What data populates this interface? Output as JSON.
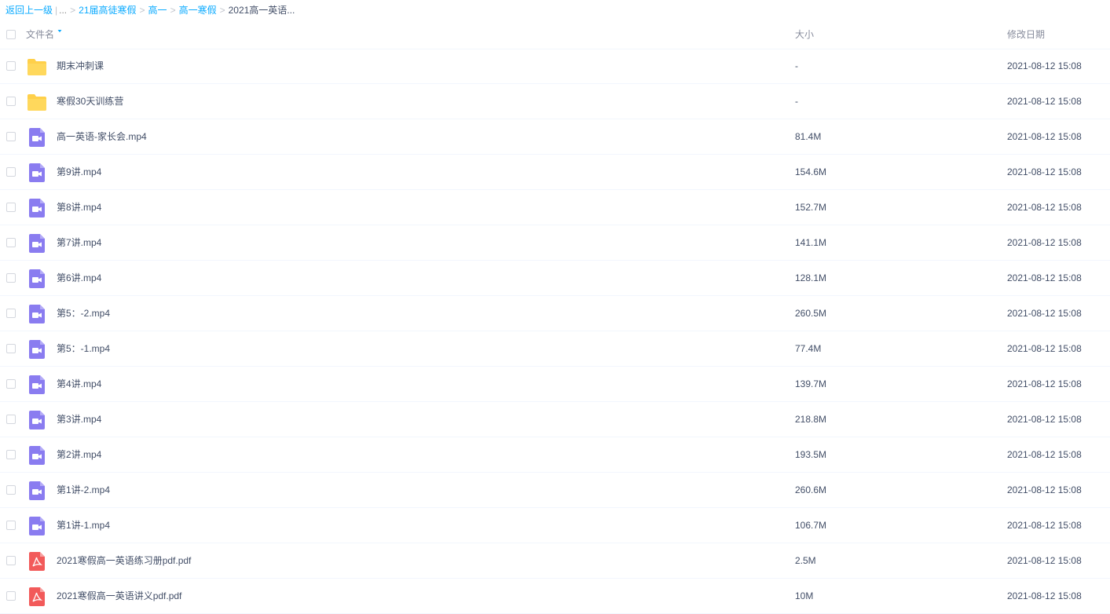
{
  "breadcrumb": {
    "back": "返回上一级",
    "ellipsis": "...",
    "items": [
      "21届高徒寒假",
      "高一",
      "高一寒假"
    ],
    "current": "2021高一英语..."
  },
  "header": {
    "name": "文件名",
    "size": "大小",
    "date": "修改日期"
  },
  "colors": {
    "folder": "#ffd04a",
    "video": "#8a7cf0",
    "pdf": "#f25a5a",
    "link": "#09aaff"
  },
  "rows": [
    {
      "icon": "folder-icon",
      "name": "期末冲刺课",
      "size": "-",
      "date": "2021-08-12 15:08"
    },
    {
      "icon": "folder-icon",
      "name": "寒假30天训练营",
      "size": "-",
      "date": "2021-08-12 15:08"
    },
    {
      "icon": "video-file-icon",
      "name": "高一英语-家长会.mp4",
      "size": "81.4M",
      "date": "2021-08-12 15:08"
    },
    {
      "icon": "video-file-icon",
      "name": "第9讲.mp4",
      "size": "154.6M",
      "date": "2021-08-12 15:08"
    },
    {
      "icon": "video-file-icon",
      "name": "第8讲.mp4",
      "size": "152.7M",
      "date": "2021-08-12 15:08"
    },
    {
      "icon": "video-file-icon",
      "name": "第7讲.mp4",
      "size": "141.1M",
      "date": "2021-08-12 15:08"
    },
    {
      "icon": "video-file-icon",
      "name": "第6讲.mp4",
      "size": "128.1M",
      "date": "2021-08-12 15:08"
    },
    {
      "icon": "video-file-icon",
      "name": "第5：-2.mp4",
      "size": "260.5M",
      "date": "2021-08-12 15:08"
    },
    {
      "icon": "video-file-icon",
      "name": "第5：-1.mp4",
      "size": "77.4M",
      "date": "2021-08-12 15:08"
    },
    {
      "icon": "video-file-icon",
      "name": "第4讲.mp4",
      "size": "139.7M",
      "date": "2021-08-12 15:08"
    },
    {
      "icon": "video-file-icon",
      "name": "第3讲.mp4",
      "size": "218.8M",
      "date": "2021-08-12 15:08"
    },
    {
      "icon": "video-file-icon",
      "name": "第2讲.mp4",
      "size": "193.5M",
      "date": "2021-08-12 15:08"
    },
    {
      "icon": "video-file-icon",
      "name": "第1讲-2.mp4",
      "size": "260.6M",
      "date": "2021-08-12 15:08"
    },
    {
      "icon": "video-file-icon",
      "name": "第1讲-1.mp4",
      "size": "106.7M",
      "date": "2021-08-12 15:08"
    },
    {
      "icon": "pdf-file-icon",
      "name": "2021寒假高一英语练习册pdf.pdf",
      "size": "2.5M",
      "date": "2021-08-12 15:08"
    },
    {
      "icon": "pdf-file-icon",
      "name": "2021寒假高一英语讲义pdf.pdf",
      "size": "10M",
      "date": "2021-08-12 15:08"
    }
  ]
}
